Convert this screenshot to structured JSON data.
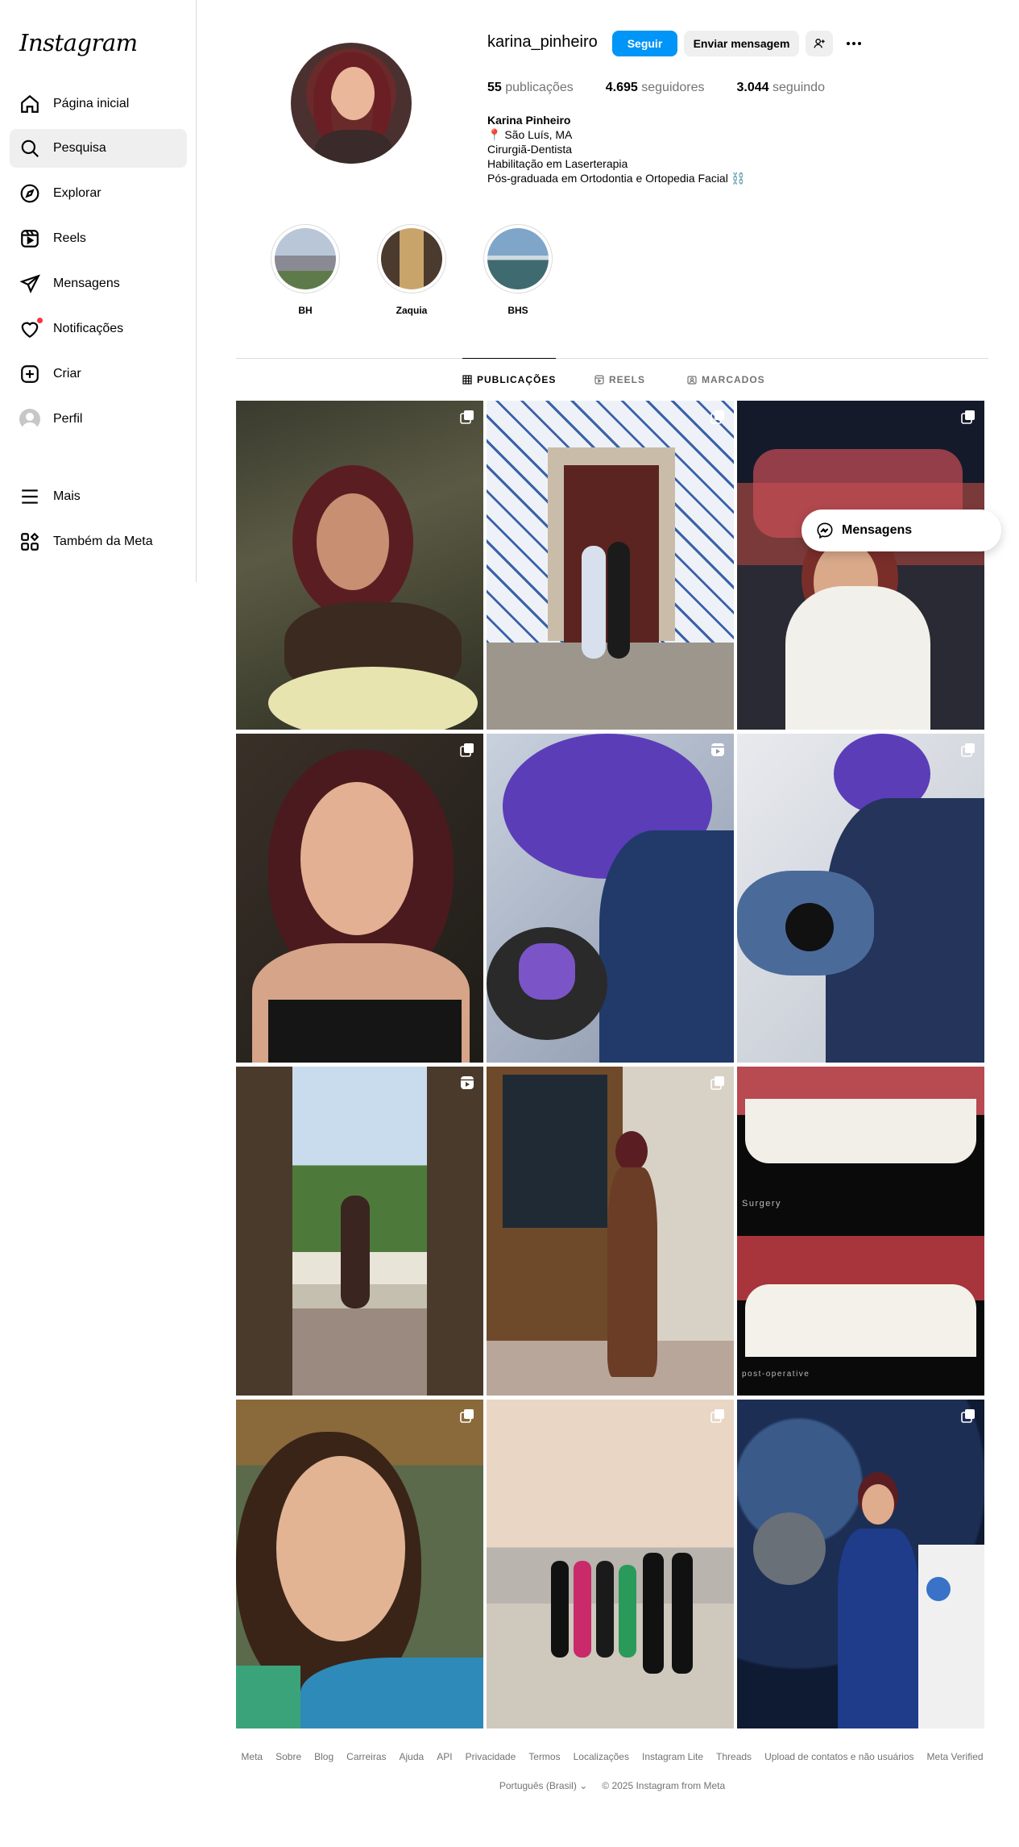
{
  "app": {
    "logo": "Instagram"
  },
  "sidebar": {
    "items": [
      {
        "label": "Página inicial",
        "icon": "home-icon"
      },
      {
        "label": "Pesquisa",
        "icon": "search-icon",
        "active": true
      },
      {
        "label": "Explorar",
        "icon": "compass-icon"
      },
      {
        "label": "Reels",
        "icon": "reels-icon"
      },
      {
        "label": "Mensagens",
        "icon": "send-icon"
      },
      {
        "label": "Notificações",
        "icon": "heart-icon"
      },
      {
        "label": "Criar",
        "icon": "plus-square-icon"
      },
      {
        "label": "Perfil",
        "icon": "avatar"
      },
      {
        "label": "Mais",
        "icon": "menu-icon"
      },
      {
        "label": "Também da Meta",
        "icon": "meta-apps-icon"
      }
    ]
  },
  "profile": {
    "username": "karina_pinheiro",
    "follow_label": "Seguir",
    "message_label": "Enviar mensagem",
    "stats": {
      "posts_count": "55",
      "posts_label": "publicações",
      "followers_count": "4.695",
      "followers_label": "seguidores",
      "following_count": "3.044",
      "following_label": "seguindo"
    },
    "bio": {
      "name": "Karina Pinheiro",
      "lines": [
        "📍 São Luís, MA",
        "Cirurgiã-Dentista",
        "Habilitação em Laserterapia",
        "Pós-graduada em Ortodontia e Ortopedia Facial ⛓️"
      ]
    }
  },
  "highlights": [
    {
      "label": "BH"
    },
    {
      "label": "Zaquia"
    },
    {
      "label": "BHS"
    }
  ],
  "tabs": [
    {
      "label": "PUBLICAÇÕES",
      "active": true
    },
    {
      "label": "REELS"
    },
    {
      "label": "MARCADOS"
    }
  ],
  "posts": [
    {
      "type": "carousel",
      "overlay_text": ""
    },
    {
      "type": "carousel",
      "overlay_text": ""
    },
    {
      "type": "carousel",
      "overlay_text": ""
    },
    {
      "type": "carousel",
      "overlay_text": ""
    },
    {
      "type": "reel",
      "overlay_text": ""
    },
    {
      "type": "carousel",
      "overlay_text": ""
    },
    {
      "type": "reel",
      "overlay_text": ""
    },
    {
      "type": "carousel",
      "overlay_text": ""
    },
    {
      "type": "image",
      "overlay_text": "Surgery",
      "overlay_text_2": "post-operative"
    },
    {
      "type": "carousel",
      "overlay_text": ""
    },
    {
      "type": "carousel",
      "overlay_text": ""
    },
    {
      "type": "carousel",
      "overlay_text": ""
    }
  ],
  "floating_messages": {
    "label": "Mensagens"
  },
  "footer": {
    "links": [
      "Meta",
      "Sobre",
      "Blog",
      "Carreiras",
      "Ajuda",
      "API",
      "Privacidade",
      "Termos",
      "Localizações",
      "Instagram Lite",
      "Threads",
      "Upload de contatos e não usuários",
      "Meta Verified"
    ],
    "language": "Português (Brasil)",
    "copyright": "© 2025 Instagram from Meta"
  },
  "colors": {
    "accent": "#0095f6",
    "notification_dot": "#ff3040",
    "muted_text": "#737373"
  }
}
